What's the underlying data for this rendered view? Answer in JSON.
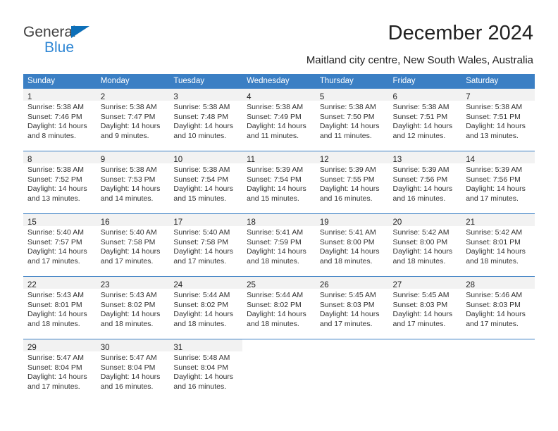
{
  "brand": {
    "name_part1": "General",
    "name_part2": "Blue",
    "triangle_color": "#0d6fb8",
    "text_color_1": "#3f3f3f",
    "text_color_2": "#2e86d4"
  },
  "header": {
    "title": "December 2024",
    "subtitle": "Maitland city centre, New South Wales, Australia"
  },
  "theme": {
    "header_blue": "#3b7fc4",
    "daynum_band": "#f2f2f2",
    "divider": "#3b7fc4"
  },
  "labels": {
    "sunrise_prefix": "Sunrise: ",
    "sunset_prefix": "Sunset: ",
    "daylight_prefix": "Daylight: "
  },
  "weekday_headers": [
    "Sunday",
    "Monday",
    "Tuesday",
    "Wednesday",
    "Thursday",
    "Friday",
    "Saturday"
  ],
  "weeks": [
    [
      {
        "day": "1",
        "sunrise": "Sunrise: 5:38 AM",
        "sunset": "Sunset: 7:46 PM",
        "daylight": "Daylight: 14 hours and 8 minutes."
      },
      {
        "day": "2",
        "sunrise": "Sunrise: 5:38 AM",
        "sunset": "Sunset: 7:47 PM",
        "daylight": "Daylight: 14 hours and 9 minutes."
      },
      {
        "day": "3",
        "sunrise": "Sunrise: 5:38 AM",
        "sunset": "Sunset: 7:48 PM",
        "daylight": "Daylight: 14 hours and 10 minutes."
      },
      {
        "day": "4",
        "sunrise": "Sunrise: 5:38 AM",
        "sunset": "Sunset: 7:49 PM",
        "daylight": "Daylight: 14 hours and 11 minutes."
      },
      {
        "day": "5",
        "sunrise": "Sunrise: 5:38 AM",
        "sunset": "Sunset: 7:50 PM",
        "daylight": "Daylight: 14 hours and 11 minutes."
      },
      {
        "day": "6",
        "sunrise": "Sunrise: 5:38 AM",
        "sunset": "Sunset: 7:51 PM",
        "daylight": "Daylight: 14 hours and 12 minutes."
      },
      {
        "day": "7",
        "sunrise": "Sunrise: 5:38 AM",
        "sunset": "Sunset: 7:51 PM",
        "daylight": "Daylight: 14 hours and 13 minutes."
      }
    ],
    [
      {
        "day": "8",
        "sunrise": "Sunrise: 5:38 AM",
        "sunset": "Sunset: 7:52 PM",
        "daylight": "Daylight: 14 hours and 13 minutes."
      },
      {
        "day": "9",
        "sunrise": "Sunrise: 5:38 AM",
        "sunset": "Sunset: 7:53 PM",
        "daylight": "Daylight: 14 hours and 14 minutes."
      },
      {
        "day": "10",
        "sunrise": "Sunrise: 5:38 AM",
        "sunset": "Sunset: 7:54 PM",
        "daylight": "Daylight: 14 hours and 15 minutes."
      },
      {
        "day": "11",
        "sunrise": "Sunrise: 5:39 AM",
        "sunset": "Sunset: 7:54 PM",
        "daylight": "Daylight: 14 hours and 15 minutes."
      },
      {
        "day": "12",
        "sunrise": "Sunrise: 5:39 AM",
        "sunset": "Sunset: 7:55 PM",
        "daylight": "Daylight: 14 hours and 16 minutes."
      },
      {
        "day": "13",
        "sunrise": "Sunrise: 5:39 AM",
        "sunset": "Sunset: 7:56 PM",
        "daylight": "Daylight: 14 hours and 16 minutes."
      },
      {
        "day": "14",
        "sunrise": "Sunrise: 5:39 AM",
        "sunset": "Sunset: 7:56 PM",
        "daylight": "Daylight: 14 hours and 17 minutes."
      }
    ],
    [
      {
        "day": "15",
        "sunrise": "Sunrise: 5:40 AM",
        "sunset": "Sunset: 7:57 PM",
        "daylight": "Daylight: 14 hours and 17 minutes."
      },
      {
        "day": "16",
        "sunrise": "Sunrise: 5:40 AM",
        "sunset": "Sunset: 7:58 PM",
        "daylight": "Daylight: 14 hours and 17 minutes."
      },
      {
        "day": "17",
        "sunrise": "Sunrise: 5:40 AM",
        "sunset": "Sunset: 7:58 PM",
        "daylight": "Daylight: 14 hours and 17 minutes."
      },
      {
        "day": "18",
        "sunrise": "Sunrise: 5:41 AM",
        "sunset": "Sunset: 7:59 PM",
        "daylight": "Daylight: 14 hours and 18 minutes."
      },
      {
        "day": "19",
        "sunrise": "Sunrise: 5:41 AM",
        "sunset": "Sunset: 8:00 PM",
        "daylight": "Daylight: 14 hours and 18 minutes."
      },
      {
        "day": "20",
        "sunrise": "Sunrise: 5:42 AM",
        "sunset": "Sunset: 8:00 PM",
        "daylight": "Daylight: 14 hours and 18 minutes."
      },
      {
        "day": "21",
        "sunrise": "Sunrise: 5:42 AM",
        "sunset": "Sunset: 8:01 PM",
        "daylight": "Daylight: 14 hours and 18 minutes."
      }
    ],
    [
      {
        "day": "22",
        "sunrise": "Sunrise: 5:43 AM",
        "sunset": "Sunset: 8:01 PM",
        "daylight": "Daylight: 14 hours and 18 minutes."
      },
      {
        "day": "23",
        "sunrise": "Sunrise: 5:43 AM",
        "sunset": "Sunset: 8:02 PM",
        "daylight": "Daylight: 14 hours and 18 minutes."
      },
      {
        "day": "24",
        "sunrise": "Sunrise: 5:44 AM",
        "sunset": "Sunset: 8:02 PM",
        "daylight": "Daylight: 14 hours and 18 minutes."
      },
      {
        "day": "25",
        "sunrise": "Sunrise: 5:44 AM",
        "sunset": "Sunset: 8:02 PM",
        "daylight": "Daylight: 14 hours and 18 minutes."
      },
      {
        "day": "26",
        "sunrise": "Sunrise: 5:45 AM",
        "sunset": "Sunset: 8:03 PM",
        "daylight": "Daylight: 14 hours and 17 minutes."
      },
      {
        "day": "27",
        "sunrise": "Sunrise: 5:45 AM",
        "sunset": "Sunset: 8:03 PM",
        "daylight": "Daylight: 14 hours and 17 minutes."
      },
      {
        "day": "28",
        "sunrise": "Sunrise: 5:46 AM",
        "sunset": "Sunset: 8:03 PM",
        "daylight": "Daylight: 14 hours and 17 minutes."
      }
    ],
    [
      {
        "day": "29",
        "sunrise": "Sunrise: 5:47 AM",
        "sunset": "Sunset: 8:04 PM",
        "daylight": "Daylight: 14 hours and 17 minutes."
      },
      {
        "day": "30",
        "sunrise": "Sunrise: 5:47 AM",
        "sunset": "Sunset: 8:04 PM",
        "daylight": "Daylight: 14 hours and 16 minutes."
      },
      {
        "day": "31",
        "sunrise": "Sunrise: 5:48 AM",
        "sunset": "Sunset: 8:04 PM",
        "daylight": "Daylight: 14 hours and 16 minutes."
      },
      {
        "day": "",
        "sunrise": "",
        "sunset": "",
        "daylight": ""
      },
      {
        "day": "",
        "sunrise": "",
        "sunset": "",
        "daylight": ""
      },
      {
        "day": "",
        "sunrise": "",
        "sunset": "",
        "daylight": ""
      },
      {
        "day": "",
        "sunrise": "",
        "sunset": "",
        "daylight": ""
      }
    ]
  ]
}
